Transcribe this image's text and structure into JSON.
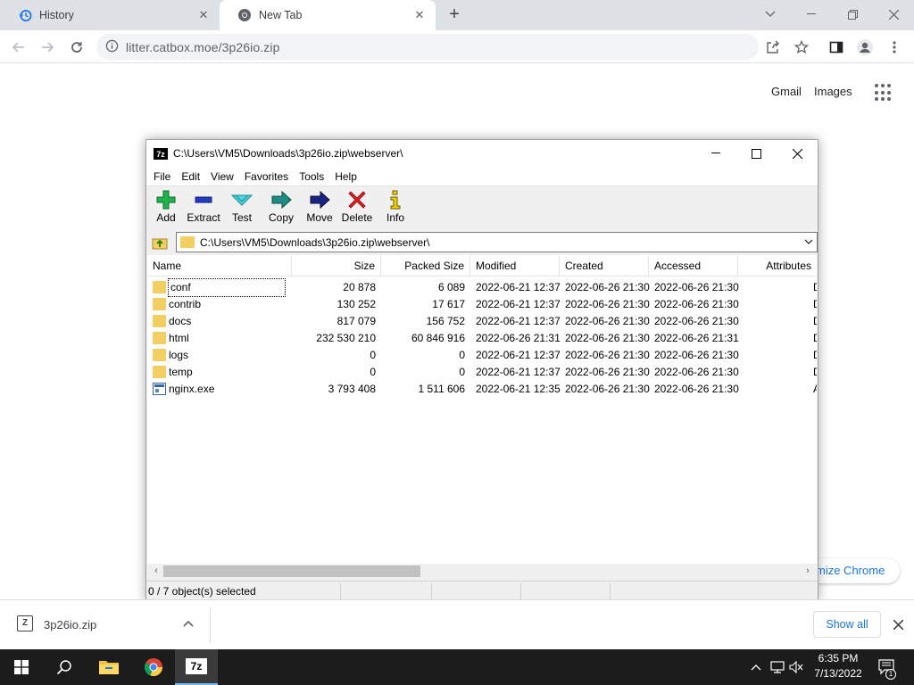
{
  "browser": {
    "tabs": [
      {
        "label": "History",
        "icon": "history-icon"
      },
      {
        "label": "New Tab",
        "icon": "chrome-icon"
      }
    ],
    "url": "litter.catbox.moe/3p26io.zip",
    "ntp": {
      "gmail": "Gmail",
      "images": "Images",
      "customize": "mize Chrome"
    }
  },
  "sevenzip": {
    "title": "C:\\Users\\VM5\\Downloads\\3p26io.zip\\webserver\\",
    "menu": [
      "File",
      "Edit",
      "View",
      "Favorites",
      "Tools",
      "Help"
    ],
    "tools": [
      {
        "label": "Add",
        "icon": "add-icon"
      },
      {
        "label": "Extract",
        "icon": "extract-icon"
      },
      {
        "label": "Test",
        "icon": "test-icon"
      },
      {
        "label": "Copy",
        "icon": "copy-icon"
      },
      {
        "label": "Move",
        "icon": "move-icon"
      },
      {
        "label": "Delete",
        "icon": "delete-icon"
      },
      {
        "label": "Info",
        "icon": "info-icon"
      }
    ],
    "path": "C:\\Users\\VM5\\Downloads\\3p26io.zip\\webserver\\",
    "columns": [
      "Name",
      "Size",
      "Packed Size",
      "Modified",
      "Created",
      "Accessed",
      "Attributes"
    ],
    "rows": [
      {
        "name": "conf",
        "type": "folder",
        "size": "20 878",
        "packed": "6 089",
        "modified": "2022-06-21 12:37",
        "created": "2022-06-26 21:30",
        "accessed": "2022-06-26 21:30",
        "attr": "D"
      },
      {
        "name": "contrib",
        "type": "folder",
        "size": "130 252",
        "packed": "17 617",
        "modified": "2022-06-21 12:37",
        "created": "2022-06-26 21:30",
        "accessed": "2022-06-26 21:30",
        "attr": "D"
      },
      {
        "name": "docs",
        "type": "folder",
        "size": "817 079",
        "packed": "156 752",
        "modified": "2022-06-21 12:37",
        "created": "2022-06-26 21:30",
        "accessed": "2022-06-26 21:30",
        "attr": "D"
      },
      {
        "name": "html",
        "type": "folder",
        "size": "232 530 210",
        "packed": "60 846 916",
        "modified": "2022-06-26 21:31",
        "created": "2022-06-26 21:30",
        "accessed": "2022-06-26 21:31",
        "attr": "D"
      },
      {
        "name": "logs",
        "type": "folder",
        "size": "0",
        "packed": "0",
        "modified": "2022-06-21 12:37",
        "created": "2022-06-26 21:30",
        "accessed": "2022-06-26 21:30",
        "attr": "D"
      },
      {
        "name": "temp",
        "type": "folder",
        "size": "0",
        "packed": "0",
        "modified": "2022-06-21 12:37",
        "created": "2022-06-26 21:30",
        "accessed": "2022-06-26 21:30",
        "attr": "D"
      },
      {
        "name": "nginx.exe",
        "type": "exe",
        "size": "3 793 408",
        "packed": "1 511 606",
        "modified": "2022-06-21 12:35",
        "created": "2022-06-26 21:30",
        "accessed": "2022-06-26 21:30",
        "attr": "A"
      }
    ],
    "status": "0 / 7 object(s) selected"
  },
  "downloads": {
    "file": "3p26io.zip",
    "show_all": "Show all"
  },
  "taskbar": {
    "time": "6:35 PM",
    "date": "7/13/2022",
    "notifications": "1"
  },
  "colors": {
    "chrome_tabstrip": "#dee1e6",
    "link_blue": "#1a73e8",
    "taskbar": "#1c1c1c",
    "folder": "#f3cf63"
  }
}
